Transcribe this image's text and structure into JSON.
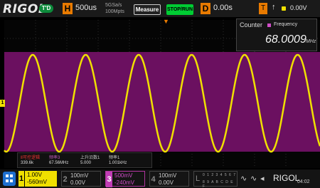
{
  "topbar": {
    "logo": "RIGOL",
    "mode_badge": "T'D",
    "h_key": "H",
    "timebase": "500us",
    "sample_rate": "5GSa/s",
    "memory_depth": "100Mpts",
    "measure_label": "Measure",
    "run_label": "STOP/RUN",
    "d_key": "D",
    "delay": "0.00s",
    "trigger_key": "T",
    "trigger_slope": "↑",
    "trigger_level": "0.00V"
  },
  "counter": {
    "title": "Counter",
    "type_label": "Frequency",
    "value": "68.0009",
    "unit": "MHz"
  },
  "measurements": {
    "headers": [
      "Ⅱ可控逻辑",
      "频率3",
      "上升沿数1",
      "频率1"
    ],
    "values": [
      "339.6k",
      "67.56MHz",
      "5.000",
      "1.001kHz"
    ]
  },
  "channels": [
    {
      "num": "1",
      "volts": "1.00V",
      "offset": "-560mV"
    },
    {
      "num": "2",
      "volts": "100mV",
      "offset": "0.00V"
    },
    {
      "num": "3",
      "volts": "500mV",
      "offset": "-240mV"
    },
    {
      "num": "4",
      "volts": "100mV",
      "offset": "0.00V"
    }
  ],
  "logic": {
    "label": "L",
    "row1": "0 1 2 3 4 5 6 7",
    "row2": "8 9 A B C D E F"
  },
  "watermark": {
    "brand": "RIGOL"
  },
  "clock": "04:02",
  "colors": {
    "ch1": "#f0e000",
    "ch3": "#c03db5",
    "accent": "#e87a00",
    "run": "#00cc33"
  }
}
